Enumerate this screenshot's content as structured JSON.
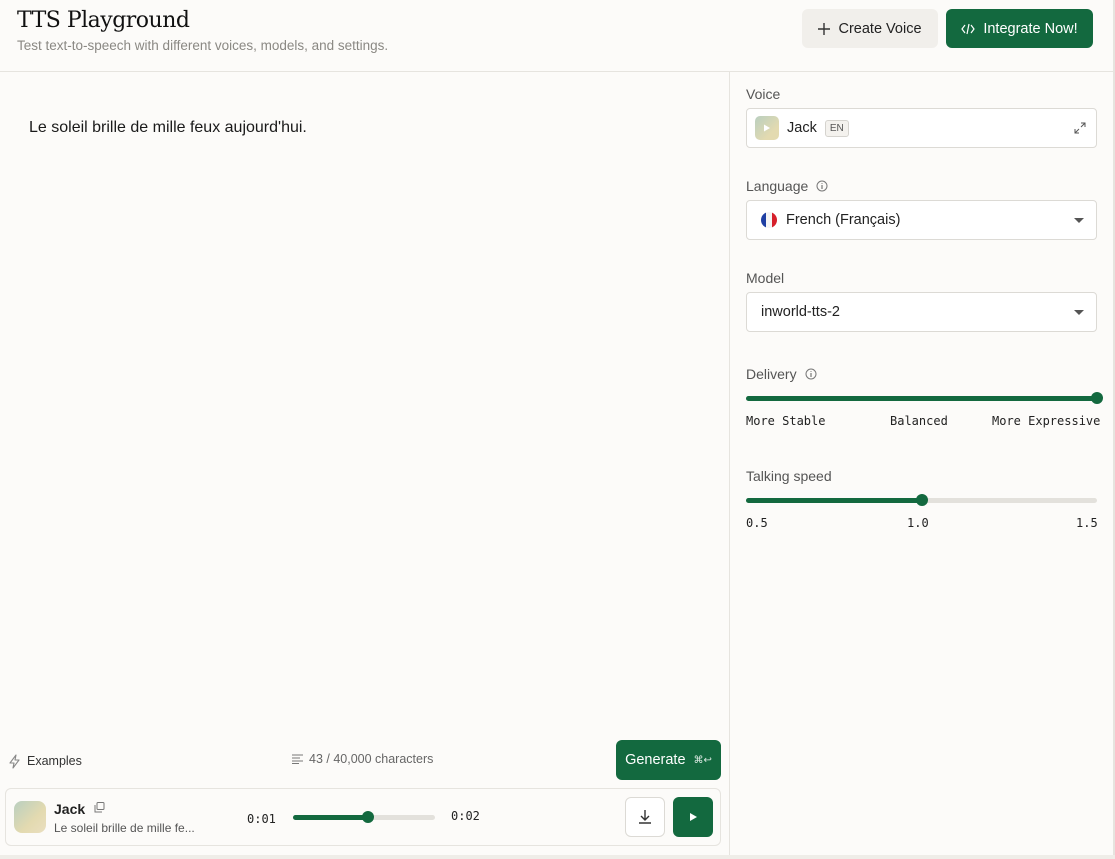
{
  "header": {
    "title": "TTS Playground",
    "subtitle": "Test text-to-speech with different voices, models, and settings.",
    "create_voice_label": "Create Voice",
    "integrate_label": "Integrate Now!"
  },
  "editor": {
    "text": "Le soleil brille de mille feux aujourd'hui.",
    "examples_label": "Examples",
    "char_count": "43 / 40,000 characters",
    "generate_label": "Generate",
    "generate_shortcut": "⌘↩"
  },
  "player": {
    "voice_name": "Jack",
    "snippet": "Le soleil brille de mille fe...",
    "current_time": "0:01",
    "duration": "0:02",
    "progress": 0.53
  },
  "settings": {
    "voice": {
      "label": "Voice",
      "value": "Jack",
      "badge": "EN"
    },
    "language": {
      "label": "Language",
      "value": "French (Français)"
    },
    "model": {
      "label": "Model",
      "value": "inworld-tts-2"
    },
    "delivery": {
      "label": "Delivery",
      "value": 1.0,
      "ticks": [
        "More Stable",
        "Balanced",
        "More Expressive"
      ]
    },
    "speed": {
      "label": "Talking speed",
      "value": 1.0,
      "min": 0.5,
      "max": 1.5,
      "ticks": [
        "0.5",
        "1.0",
        "1.5"
      ]
    }
  },
  "colors": {
    "accent": "#13693f",
    "background": "#fcfbf9",
    "border": "#e6e4df"
  }
}
